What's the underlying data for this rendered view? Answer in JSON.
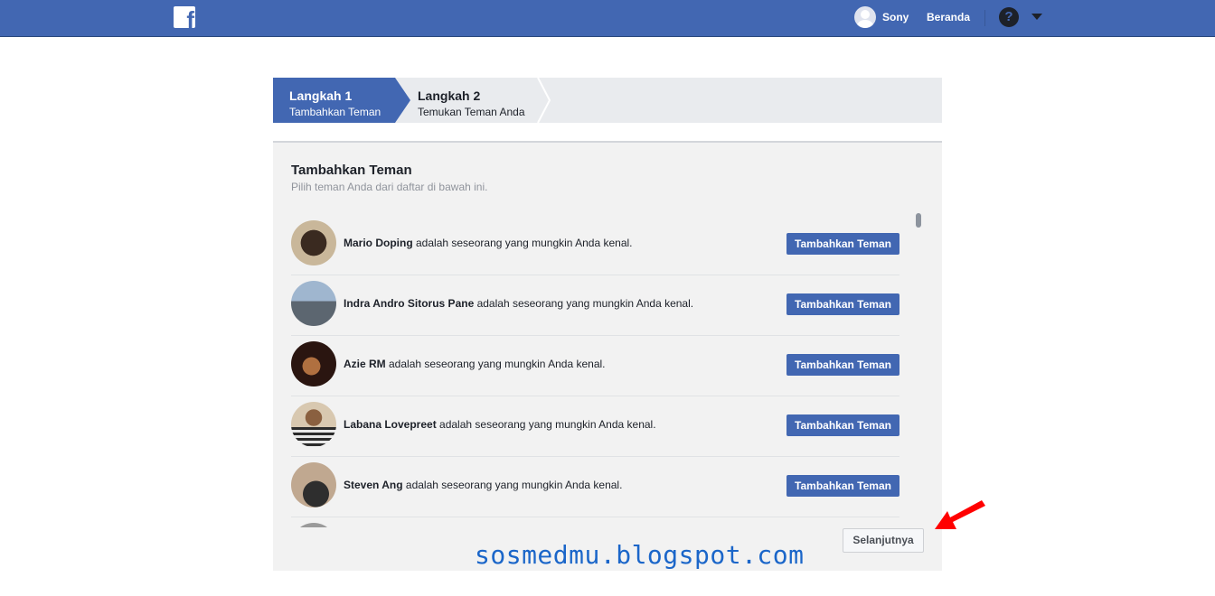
{
  "topbar": {
    "logo_glyph": "f",
    "user_name": "Sony",
    "home_label": "Beranda",
    "help_glyph": "?"
  },
  "steps": [
    {
      "title": "Langkah 1",
      "subtitle": "Tambahkan Teman",
      "active": true
    },
    {
      "title": "Langkah 2",
      "subtitle": "Temukan Teman Anda",
      "active": false
    }
  ],
  "panel": {
    "title": "Tambahkan Teman",
    "subtitle": "Pilih teman Anda dari daftar di bawah ini.",
    "suffix": " adalah seseorang yang mungkin Anda kenal.",
    "add_button_label": "Tambahkan Teman",
    "next_label": "Selanjutnya"
  },
  "people": [
    {
      "name": "Mario Doping"
    },
    {
      "name": "Indra Andro Sitorus Pane"
    },
    {
      "name": "Azie RM"
    },
    {
      "name": "Labana Lovepreet"
    },
    {
      "name": "Steven Ang"
    }
  ],
  "watermark": "sosmedmu.blogspot.com",
  "colors": {
    "brand": "#4267b2",
    "arrow": "#ff0000",
    "watermark": "#1b66c9"
  }
}
